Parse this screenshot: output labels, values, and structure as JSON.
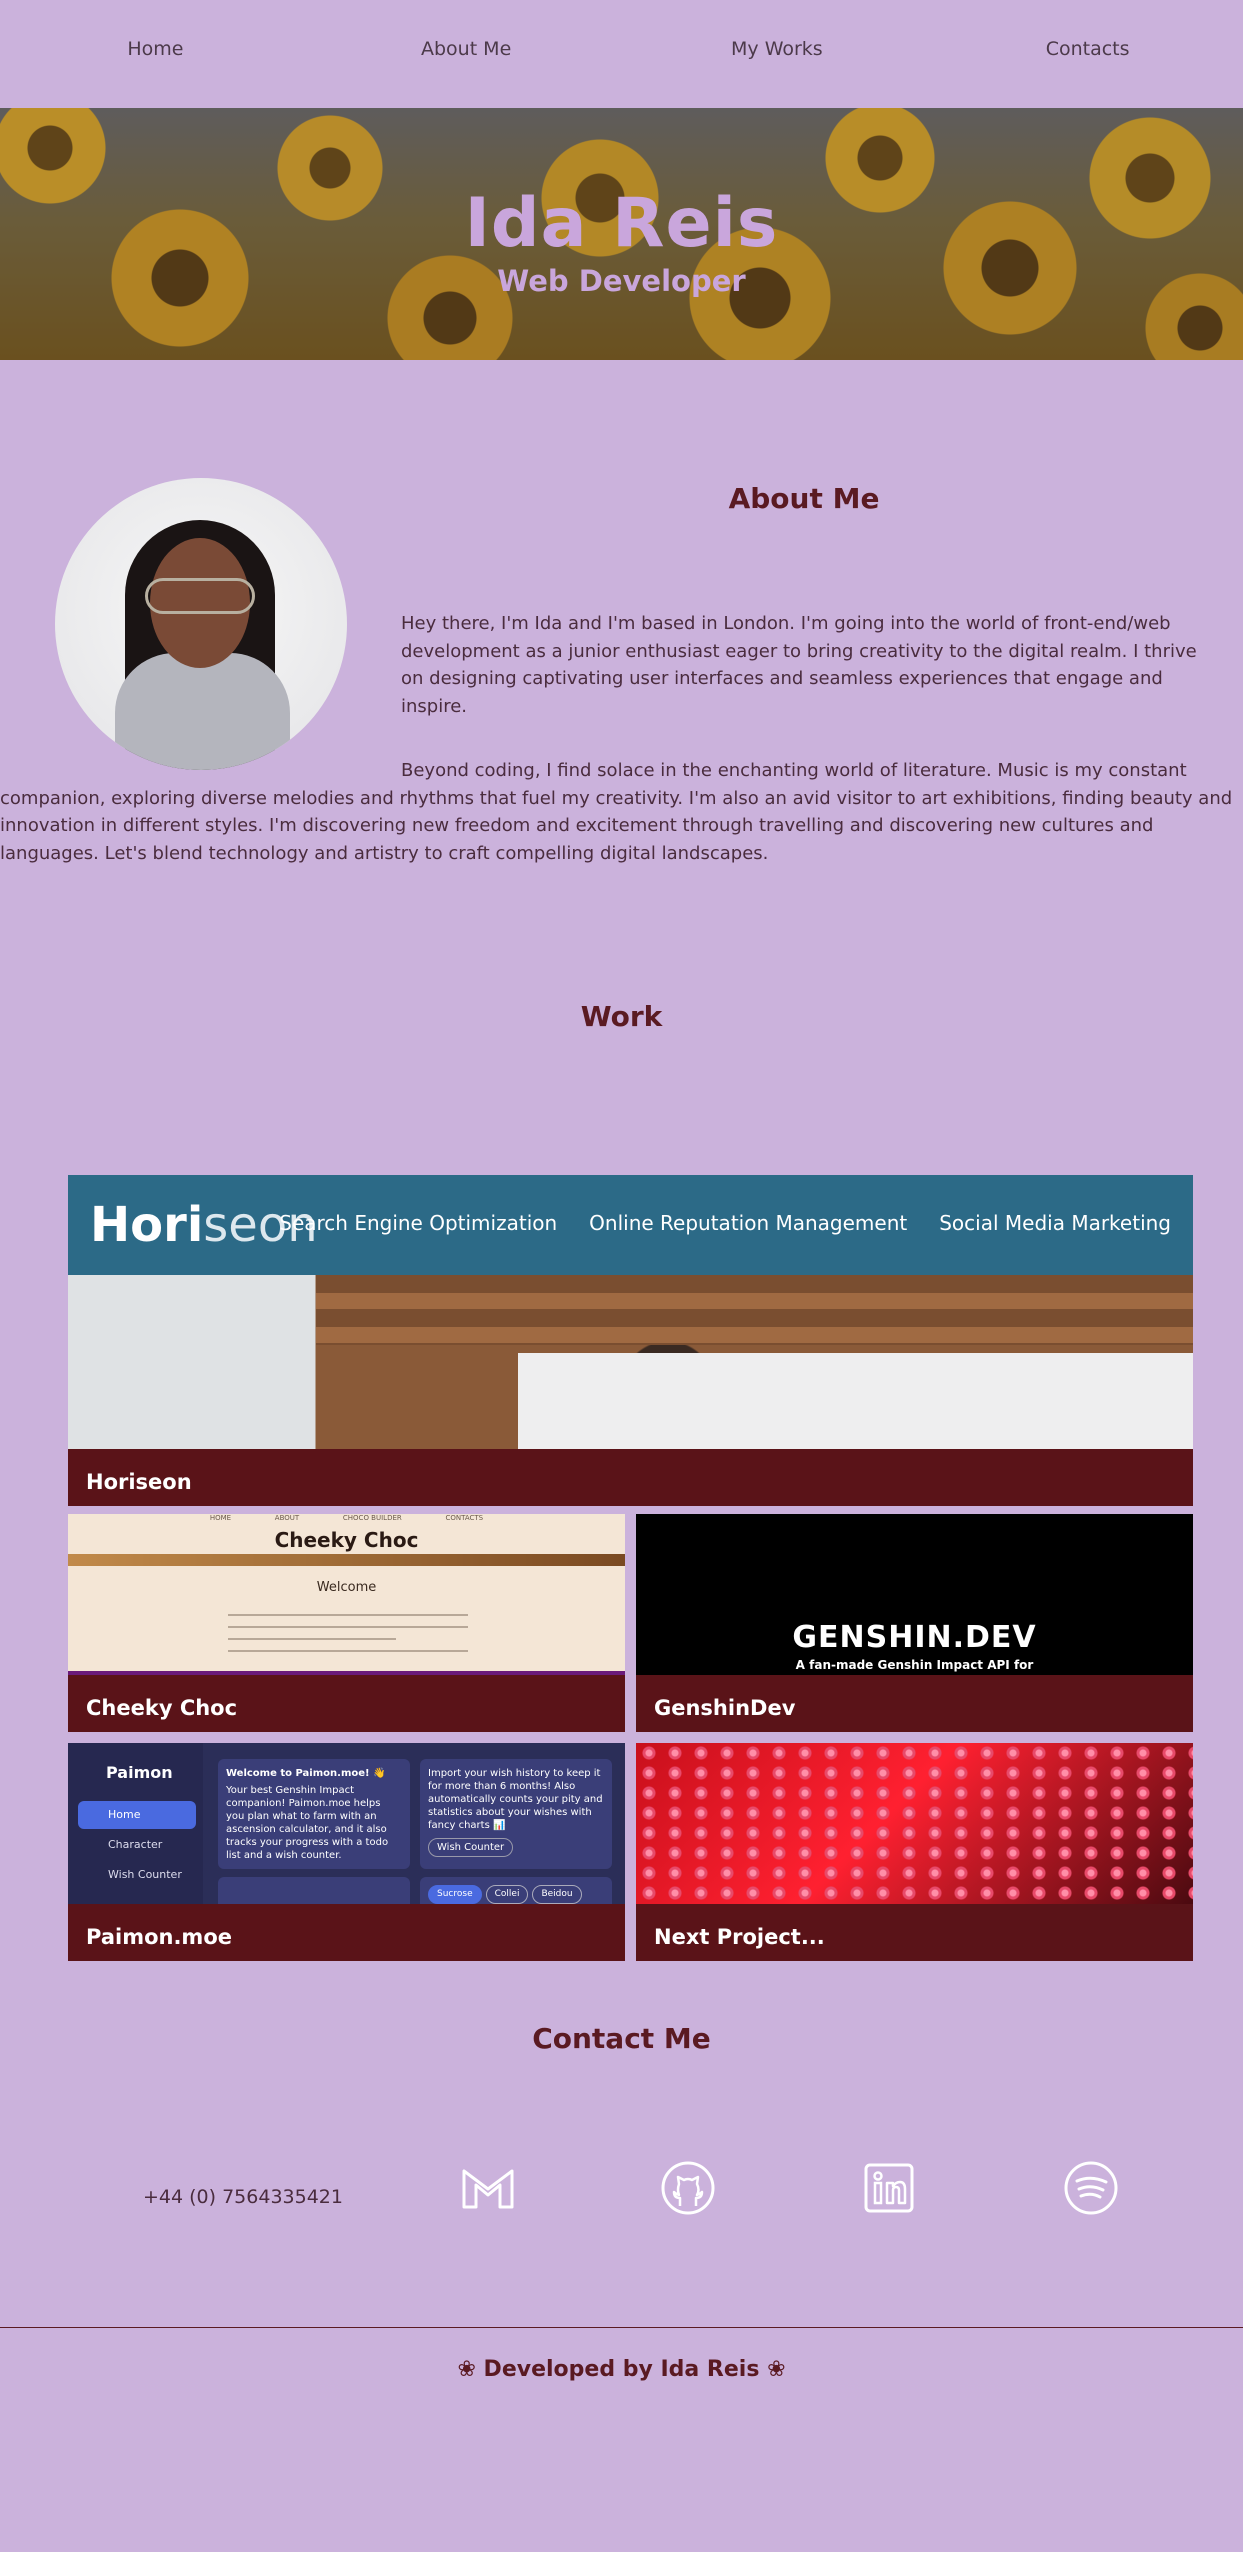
{
  "nav": {
    "items": [
      "Home",
      "About Me",
      "My Works",
      "Contacts"
    ]
  },
  "hero": {
    "name": "Ida Reis",
    "role": "Web Developer"
  },
  "about": {
    "title": "About Me",
    "paragraph1": "Hey there, I'm Ida and I'm based in London. I'm going into the world of front-end/web development as a junior enthusiast eager to bring creativity to the digital realm. I thrive on designing captivating user interfaces and seamless experiences that engage and inspire.",
    "paragraph2": "Beyond coding, I find solace in the enchanting world of literature. Music is my constant companion, exploring diverse melodies and rhythms that fuel my creativity. I'm also an avid visitor to art exhibitions, finding beauty and innovation in different styles. I'm discovering new freedom and excitement through travelling and discovering new cultures and languages. Let's blend technology and artistry to craft compelling digital landscapes."
  },
  "work": {
    "title": "Work",
    "projects": [
      {
        "label": "Horiseon",
        "logo_main": "Hori",
        "logo_rest": "seon",
        "links": [
          "Search Engine Optimization",
          "Online Reputation Management",
          "Social Media Marketing"
        ]
      },
      {
        "label": "Cheeky Choc",
        "nav": [
          "HOME",
          "ABOUT",
          "CHOCO BUILDER",
          "CONTACTS"
        ],
        "heading": "Cheeky Choc",
        "welcome": "Welcome"
      },
      {
        "label": "GenshinDev",
        "heading": "GENSHIN.DEV",
        "sub": "A fan-made Genshin Impact API for"
      },
      {
        "label": "Paimon.moe",
        "logo": "Paimon",
        "menu": [
          "Home",
          "Character",
          "Wish Counter"
        ],
        "welcome_title": "Welcome to Paimon.moe! 👋",
        "welcome_text": "Your best Genshin Impact companion! Paimon.moe helps you plan what to farm with an ascension calculator, and it also tracks your progress with a todo list and a wish counter.",
        "import_text": "Import your wish history to keep it for more than 6 months! Also automatically counts your pity and statistics about your wishes with fancy charts 📊",
        "wish_button": "Wish Counter",
        "pills": [
          "Sucrose",
          "Collei",
          "Beidou"
        ]
      },
      {
        "label": "Next Project..."
      }
    ]
  },
  "contact": {
    "title": "Contact Me",
    "phone": "+44 (0) 7564335421",
    "icons": [
      "gmail-icon",
      "github-icon",
      "linkedin-icon",
      "spotify-icon"
    ]
  },
  "footer": {
    "text": "❀ Developed by Ida Reis ❀"
  },
  "colors": {
    "background": "#cbb2dc",
    "heading": "#5a1a22",
    "card_label_bg": "#5a1318",
    "hero_text": "#c9a6dc"
  }
}
